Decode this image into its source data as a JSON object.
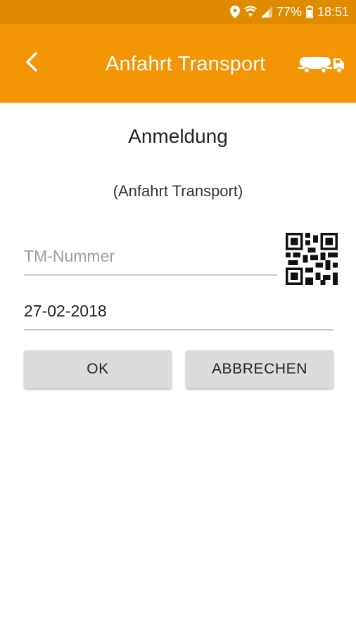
{
  "status_bar": {
    "battery": "77%",
    "time": "18:51",
    "icons": [
      "location-icon",
      "wifi-icon",
      "signal-icon",
      "battery-icon"
    ]
  },
  "app_bar": {
    "title": "Anfahrt Transport",
    "icons": [
      "back-arrow-icon",
      "tanker-truck-icon"
    ]
  },
  "form": {
    "heading": "Anmeldung",
    "subheading": "(Anfahrt Transport)",
    "tm_number": {
      "value": "",
      "placeholder": "TM-Nummer"
    },
    "date": {
      "value": "27-02-2018"
    },
    "qr_icon": "qr-code-icon"
  },
  "buttons": {
    "ok": "OK",
    "cancel": "ABBRECHEN"
  },
  "colors": {
    "status_bar": "#e08a00",
    "app_bar": "#f39505",
    "button_bg": "#dcdcdc"
  }
}
